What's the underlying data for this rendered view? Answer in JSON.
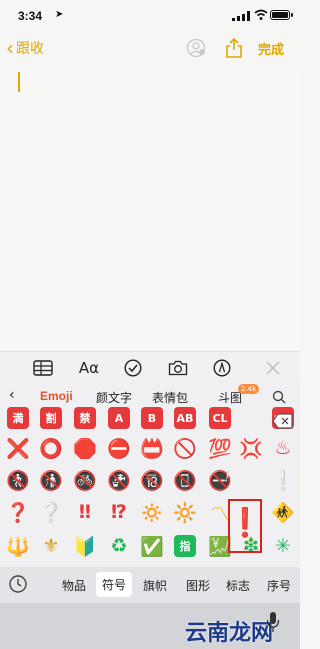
{
  "status": {
    "time": "3:34",
    "location_glyph": "➤"
  },
  "nav": {
    "back_label": "跟收",
    "done_label": "完成"
  },
  "format_bar": {
    "text_style_label": "Aα"
  },
  "keyboard": {
    "categories": [
      "Emoji",
      "颜文字",
      "表情包",
      "斗图"
    ],
    "badge": "2.4k",
    "rows": [
      [
        "満",
        "割",
        "禁",
        "A",
        "B",
        "AB",
        "CL",
        "SOS"
      ],
      [
        "❌",
        "⭕",
        "🛑",
        "⛔",
        "📛",
        "🚫",
        "💯",
        "💢",
        "♨"
      ],
      [
        "🚷",
        "🚯",
        "🚳",
        "🚱",
        "🔞",
        "📵",
        "🚭",
        "❗",
        "❕"
      ],
      [
        "❓",
        "❔",
        "‼",
        "⁉",
        "🔅",
        "🔆",
        "〽",
        "⚠",
        "🚸"
      ],
      [
        "🔱",
        "⚜",
        "🔰",
        "♻",
        "✅",
        "指",
        "💹",
        "❇",
        "✳"
      ]
    ],
    "bottom_tabs": [
      "物品",
      "符号",
      "旗帜",
      "图形",
      "标志",
      "序号"
    ],
    "active_tab": "符号",
    "watermark": "云南龙网"
  },
  "colors": {
    "accent": "#e0a800",
    "emoji_tab": "#e2522c",
    "highlight": "#d9231f"
  }
}
